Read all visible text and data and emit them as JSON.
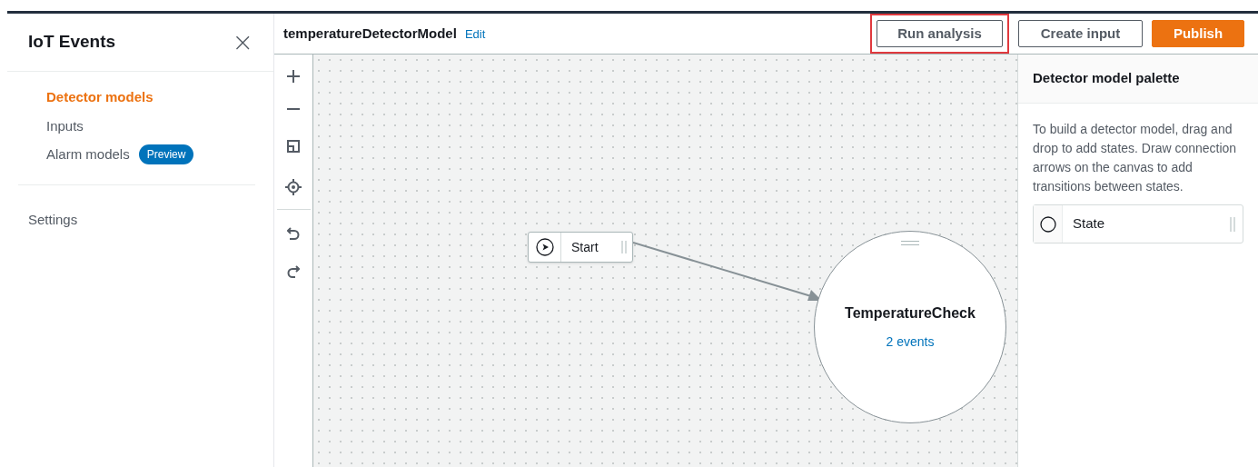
{
  "sidebar": {
    "title": "IoT Events",
    "close": "×",
    "items": [
      {
        "label": "Detector models",
        "selected": true
      },
      {
        "label": "Inputs",
        "selected": false
      },
      {
        "label": "Alarm models",
        "selected": false,
        "badge": "Preview"
      }
    ],
    "footer_items": [
      {
        "label": "Settings",
        "selected": false
      }
    ]
  },
  "header": {
    "model_name": "temperatureDetectorModel",
    "edit_link": "Edit",
    "buttons": [
      {
        "label": "Run analysis",
        "kind": "normal",
        "highlighted": true
      },
      {
        "label": "Create input",
        "kind": "normal",
        "highlighted": false
      },
      {
        "label": "Publish",
        "kind": "primary",
        "highlighted": false
      }
    ]
  },
  "canvas": {
    "start_node": {
      "label": "Start"
    },
    "states": [
      {
        "name": "TemperatureCheck",
        "events": "2 events"
      }
    ]
  },
  "palette": {
    "title": "Detector model palette",
    "description": "To build a detector model, drag and drop to add states. Draw connection arrows on the canvas to add transitions between states.",
    "items": [
      {
        "label": "State"
      }
    ]
  }
}
